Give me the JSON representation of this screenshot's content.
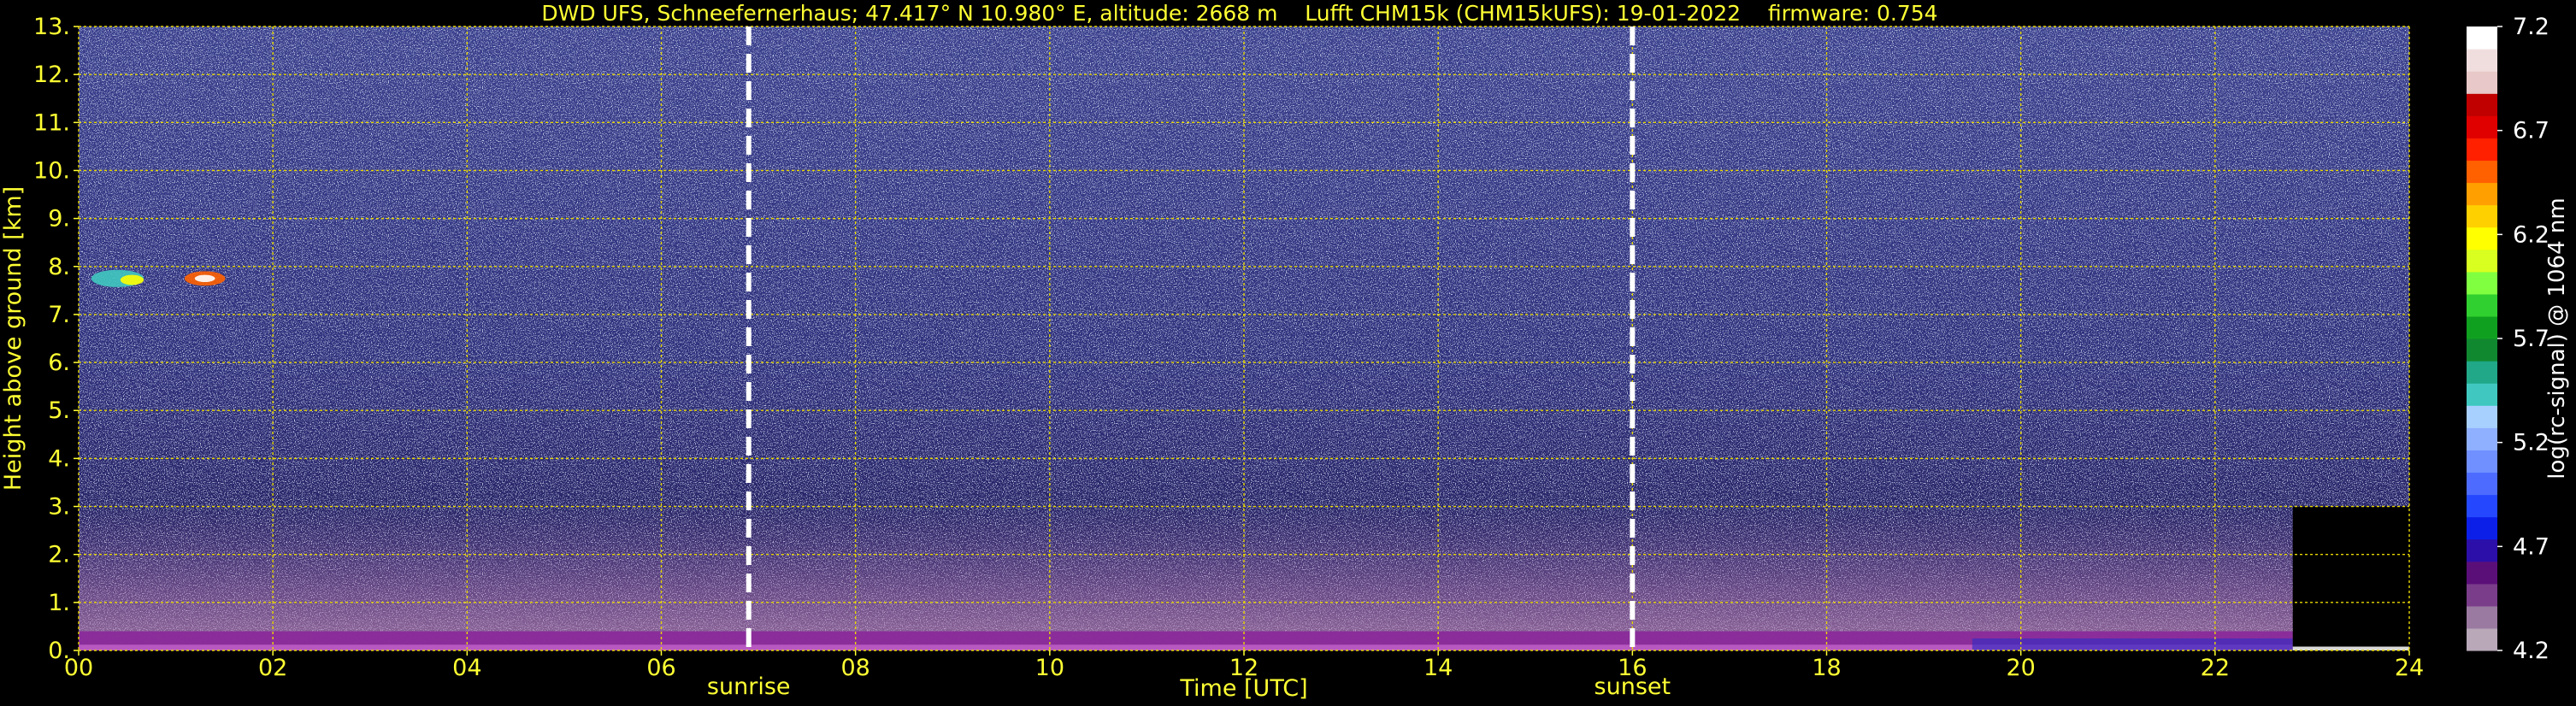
{
  "chart_data": {
    "type": "heatmap",
    "title": "DWD UFS, Schneefernerhaus; 47.417° N 10.980° E, altitude: 2668 m    Lufft CHM15k (CHM15kUFS): 19-01-2022    firmware: 0.754",
    "xlabel": "Time [UTC]",
    "ylabel": "Height above ground [km]",
    "xlim": [
      0,
      24
    ],
    "ylim": [
      0,
      13
    ],
    "x_ticks": [
      "00",
      "02",
      "04",
      "06",
      "08",
      "10",
      "12",
      "14",
      "16",
      "18",
      "20",
      "22",
      "24"
    ],
    "y_ticks": [
      "0.",
      "1.",
      "2.",
      "3.",
      "4.",
      "5.",
      "6.",
      "7.",
      "8.",
      "9.",
      "10.",
      "11.",
      "12.",
      "13."
    ],
    "grid": true,
    "events": [
      {
        "label": "sunrise",
        "time": 6.9
      },
      {
        "label": "sunset",
        "time": 16.0
      }
    ],
    "colorbar": {
      "label": "log(rc-signal) @ 1064 nm",
      "min": 4.2,
      "max": 7.2,
      "ticks": [
        "4.2",
        "4.7",
        "5.2",
        "5.7",
        "6.2",
        "6.7",
        "7.2"
      ],
      "colors": [
        "#b8a8b8",
        "#9a7aa0",
        "#7a3d8a",
        "#5a0f78",
        "#2b0fa8",
        "#0b1fe8",
        "#2548ff",
        "#4d6cff",
        "#7090ff",
        "#8fb0ff",
        "#a8d0ff",
        "#40c8c0",
        "#20a888",
        "#108830",
        "#10a020",
        "#30d030",
        "#80ff40",
        "#d8ff20",
        "#ffff00",
        "#ffd000",
        "#ffa000",
        "#ff6000",
        "#ff2000",
        "#e00000",
        "#c00000",
        "#e8c8c8",
        "#f0dede",
        "#ffffff"
      ]
    },
    "features": [
      {
        "name": "cirrus",
        "x_range": [
          0.0,
          1.5
        ],
        "y_range": [
          7.6,
          7.9
        ]
      },
      {
        "name": "boundary-layer",
        "x_range": [
          0,
          22.8
        ],
        "y_range": [
          0.0,
          0.4
        ]
      },
      {
        "name": "low-signal-block",
        "x_range": [
          22.8,
          24
        ],
        "y_range": [
          0.0,
          3.0
        ]
      }
    ]
  }
}
